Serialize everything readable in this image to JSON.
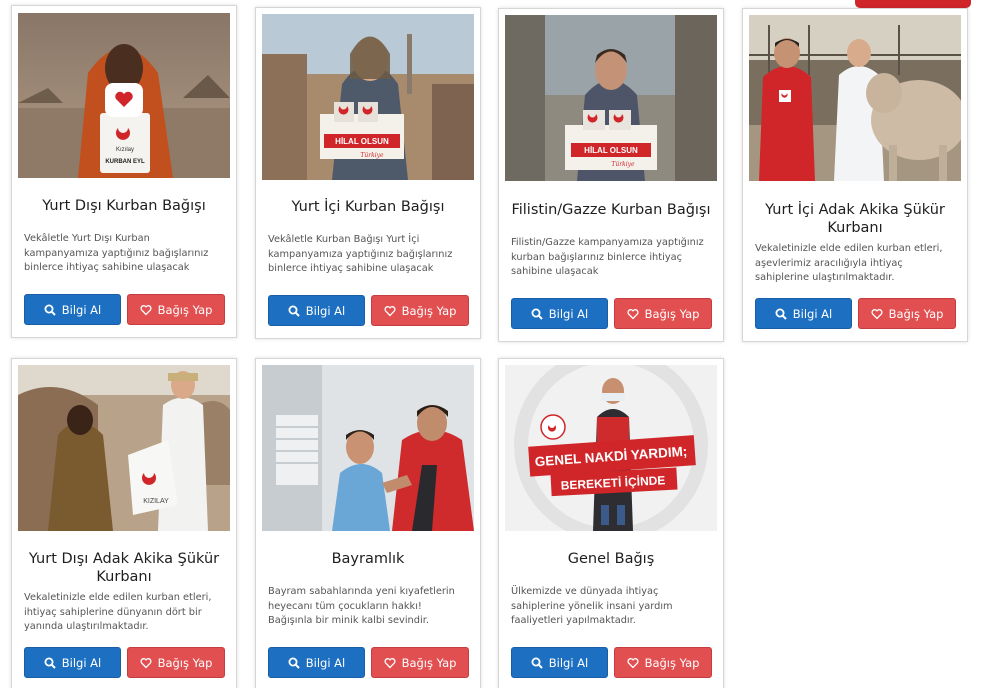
{
  "buttons": {
    "info_label": "Bilgi Al",
    "donate_label": "Bağış Yap"
  },
  "cards": [
    {
      "title": "Yurt Dışı Kurban Bağışı",
      "description": "Vekâletle Yurt Dışı Kurban kampanyamıza yaptığınız bağışlarınız binlerce ihtiyaç sahibine ulaşacak",
      "photo_text": [
        "Kızılay",
        "KURBAN EYL"
      ],
      "photo_badge": "heart-icon"
    },
    {
      "title": "Yurt İçi Kurban Bağışı",
      "description": "Vekâletle Kurban Bağışı Yurt İçi kampanyamıza yaptığınız bağışlarınız binlerce ihtiyaç sahibine ulaşacak",
      "photo_text": [
        "HİLAL OLSUN",
        "Türkiye"
      ]
    },
    {
      "title": "Filistin/Gazze Kurban Bağışı",
      "description": "Filistin/Gazze kampanyamıza yaptığınız kurban bağışlarınız binlerce ihtiyaç sahibine ulaşacak",
      "photo_text": [
        "HİLAL OLSUN",
        "Türkiye"
      ]
    },
    {
      "title": "Yurt İçi Adak Akika Şükür Kurbanı",
      "description": "Vekaletinizle elde edilen kurban etleri, aşevlerimiz aracılığıyla ihtiyaç sahiplerine ulaştırılmaktadır."
    },
    {
      "title": "Yurt Dışı Adak Akika Şükür Kurbanı",
      "description": "Vekaletinizle elde edilen kurban etleri, ihtiyaç sahiplerine dünyanın dört bir yanında ulaştırılmaktadır.",
      "photo_text": [
        "KIZILAY"
      ]
    },
    {
      "title": "Bayramlık",
      "description": "Bayram sabahlarında yeni kıyafetlerin heyecanı tüm çocukların hakkı! Bağışınla bir minik kalbi sevindir."
    },
    {
      "title": "Genel Bağış",
      "description": "Ülkemizde ve dünyada ihtiyaç sahiplerine yönelik insani yardım faaliyetleri yapılmaktadır.",
      "photo_text": [
        "GENEL NAKDİ YARDIM;",
        "BEREKETİ İÇİNDE"
      ]
    }
  ],
  "colors": {
    "info_button": "#1d70c1",
    "donate_button": "#e14f50",
    "brand_red": "#d0262a"
  }
}
